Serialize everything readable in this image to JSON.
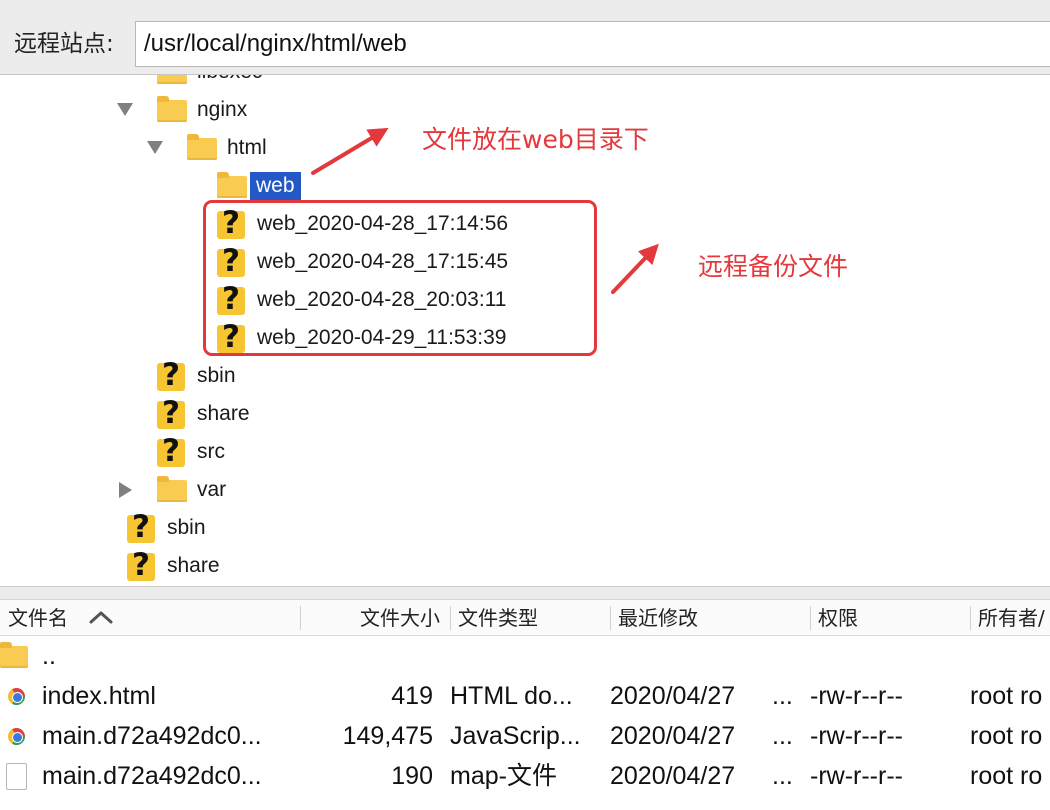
{
  "remote_site": {
    "label": "远程站点:",
    "path": "/usr/local/nginx/html/web"
  },
  "tree": {
    "items": [
      {
        "label": "libexec",
        "icon": "folder-icon"
      },
      {
        "label": "nginx",
        "icon": "folder-icon",
        "expanded": true
      },
      {
        "label": "html",
        "icon": "folder-icon",
        "expanded": true
      },
      {
        "label": "web",
        "icon": "folder-icon",
        "selected": true
      },
      {
        "label": "web_2020-04-28_17:14:56",
        "icon": "unknown-file-icon"
      },
      {
        "label": "web_2020-04-28_17:15:45",
        "icon": "unknown-file-icon"
      },
      {
        "label": "web_2020-04-28_20:03:11",
        "icon": "unknown-file-icon"
      },
      {
        "label": "web_2020-04-29_11:53:39",
        "icon": "unknown-file-icon"
      },
      {
        "label": "sbin",
        "icon": "unknown-file-icon"
      },
      {
        "label": "share",
        "icon": "unknown-file-icon"
      },
      {
        "label": "src",
        "icon": "unknown-file-icon"
      },
      {
        "label": "var",
        "icon": "folder-icon",
        "expanded": false
      },
      {
        "label": "sbin",
        "icon": "unknown-file-icon"
      },
      {
        "label": "share",
        "icon": "unknown-file-icon"
      }
    ]
  },
  "annotations": {
    "web_dir_note": "文件放在web目录下",
    "backup_note": "远程备份文件",
    "color": "#e4393c"
  },
  "file_list": {
    "columns": {
      "name": "文件名",
      "size": "文件大小",
      "type": "文件类型",
      "modified": "最近修改",
      "permissions": "权限",
      "owner": "所有者/"
    },
    "sort_icon": "chevron-up-icon",
    "rows": [
      {
        "icon": "folder-icon",
        "name": ".."
      },
      {
        "icon": "chrome-html-icon",
        "name": "index.html",
        "size": "419",
        "type": "HTML do...",
        "modified": "2020/04/27",
        "modified_overflow": "...",
        "permissions": "-rw-r--r--",
        "owner": "root ro"
      },
      {
        "icon": "chrome-html-icon",
        "name": "main.d72a492dc0...",
        "size": "149,475",
        "type": "JavaScrip...",
        "modified": "2020/04/27",
        "modified_overflow": "...",
        "permissions": "-rw-r--r--",
        "owner": "root ro"
      },
      {
        "icon": "plain-file-icon",
        "name": "main.d72a492dc0...",
        "size": "190",
        "type": "map-文件",
        "modified": "2020/04/27",
        "modified_overflow": "...",
        "permissions": "-rw-r--r--",
        "owner": "root ro"
      }
    ]
  },
  "colors": {
    "selection": "#2458c6",
    "folder": "#f9cb50",
    "unknown_icon": "#f7c531",
    "toolbar_bg": "#ececec"
  }
}
